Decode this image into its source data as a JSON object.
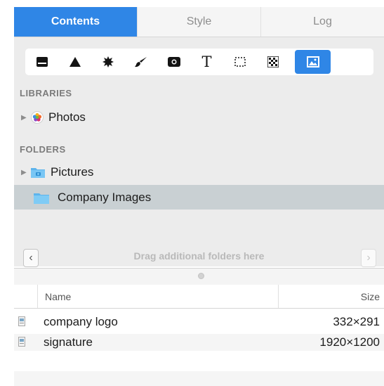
{
  "tabs": [
    {
      "label": "Contents",
      "active": true
    },
    {
      "label": "Style",
      "active": false
    },
    {
      "label": "Log",
      "active": false
    }
  ],
  "toolbar_icons": [
    "shape-box-icon",
    "triangle-icon",
    "starburst-icon",
    "brush-icon",
    "camera-icon",
    "text-icon",
    "dashed-rect-icon",
    "checkerboard-icon",
    "image-icon"
  ],
  "sidebar": {
    "libraries_heading": "LIBRARIES",
    "photos_label": "Photos",
    "folders_heading": "FOLDERS",
    "pictures_label": "Pictures",
    "company_images_label": "Company Images",
    "drag_hint": "Drag additional folders here"
  },
  "file_list": {
    "columns": {
      "name": "Name",
      "size": "Size"
    },
    "rows": [
      {
        "name": "company logo",
        "size": "332×291"
      },
      {
        "name": "signature",
        "size": "1920×1200"
      }
    ]
  },
  "colors": {
    "accent": "#2f86e6",
    "selection_row": "#c9d0d3",
    "panel_bg": "#ececec"
  }
}
